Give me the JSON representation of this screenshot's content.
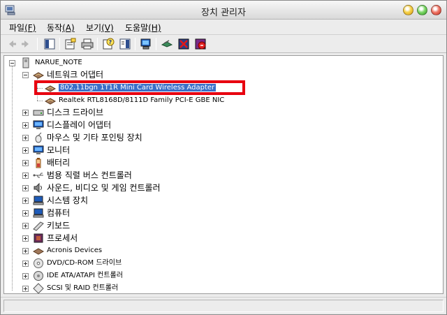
{
  "window": {
    "title": "장치 관리자"
  },
  "menu": [
    {
      "label": "파일",
      "mnemonic": "(F)"
    },
    {
      "label": "동작",
      "mnemonic": "(A)"
    },
    {
      "label": "보기",
      "mnemonic": "(V)"
    },
    {
      "label": "도움말",
      "mnemonic": "(H)"
    }
  ],
  "tree": {
    "root": "NARUE_NOTE",
    "network": {
      "label": "네트워크 어댑터",
      "children": [
        "802.11bgn 1T1R Mini Card Wireless Adapter",
        "Realtek RTL8168D/8111D Family PCI-E GBE NIC"
      ]
    },
    "categories": [
      "디스크 드라이브",
      "디스플레이 어댑터",
      "마우스 및 기타 포인팅 장치",
      "모니터",
      "배터리",
      "범용 직렬 버스 컨트롤러",
      "사운드, 비디오 및 게임 컨트롤러",
      "시스템 장치",
      "컴퓨터",
      "키보드",
      "프로세서",
      "Acronis Devices",
      "DVD/CD-ROM 드라이브",
      "IDE ATA/ATAPI 컨트롤러",
      "SCSI 및 RAID 컨트롤러"
    ]
  },
  "colors": {
    "selection": "#3a6fc8",
    "annotation": "#e8000f"
  }
}
